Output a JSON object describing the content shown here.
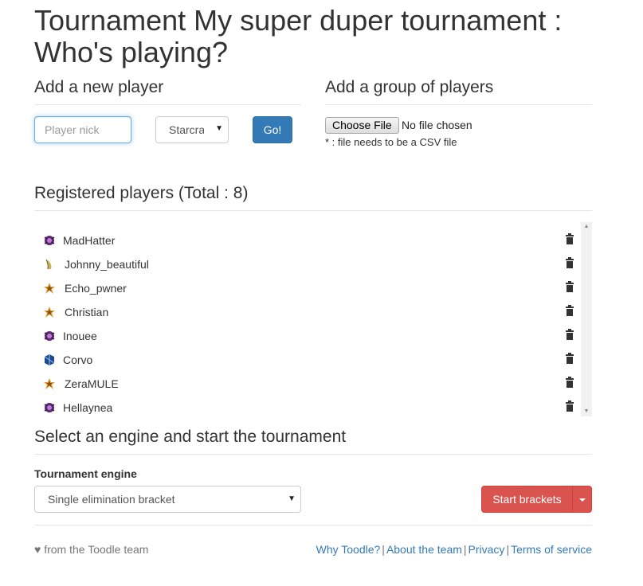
{
  "page_title": "Tournament My super duper tournament : Who's playing?",
  "add_player": {
    "heading": "Add a new player",
    "nick_placeholder": "Player nick",
    "game_selected": "Starcraft",
    "go_label": "Go!"
  },
  "add_group": {
    "heading": "Add a group of players",
    "choose_file_label": "Choose File",
    "file_status": "No file chosen",
    "hint": "* : file needs to be a CSV file"
  },
  "registered": {
    "heading": "Registered players (Total : 8)",
    "players": [
      {
        "nick": "MadHatter",
        "race": "zerg"
      },
      {
        "nick": "Johnny_beautiful",
        "race": "random"
      },
      {
        "nick": "Echo_pwner",
        "race": "protoss"
      },
      {
        "nick": "Christian",
        "race": "protoss"
      },
      {
        "nick": "Inouee",
        "race": "zerg"
      },
      {
        "nick": "Corvo",
        "race": "terran"
      },
      {
        "nick": "ZeraMULE",
        "race": "protoss"
      },
      {
        "nick": "Hellaynea",
        "race": "zerg"
      }
    ]
  },
  "engine": {
    "heading": "Select an engine and start the tournament",
    "label": "Tournament engine",
    "selected": "Single elimination bracket",
    "start_label": "Start brackets"
  },
  "footer": {
    "left": "♥ from the Toodle team",
    "links": [
      "Why Toodle?",
      "About the team",
      "Privacy",
      "Terms of service"
    ],
    "separator": "|"
  },
  "colors": {
    "primary": "#337ab7",
    "danger": "#d9534f",
    "text": "#333333",
    "muted": "#777777"
  }
}
